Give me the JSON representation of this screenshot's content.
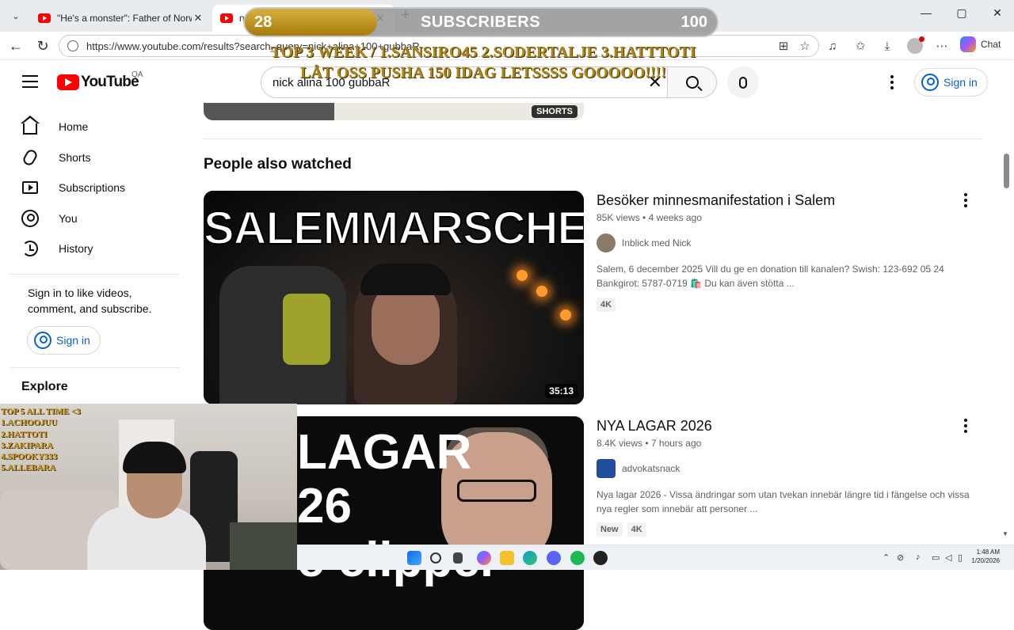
{
  "browser": {
    "tabs": [
      {
        "title": "\"He's a monster\": Father of Norwa",
        "active": false
      },
      {
        "title": "ni",
        "active": true
      }
    ],
    "url": "https://www.youtube.com/results?search_query=nick+alina+100+gubbaR",
    "chat_label": "Chat"
  },
  "youtube": {
    "logo_text": "YouTube",
    "country_code": "QA",
    "search_value": "nick alina 100 gubbaR",
    "signin_label": "Sign in"
  },
  "sidebar": {
    "items": [
      {
        "label": "Home",
        "icon": "home-icon"
      },
      {
        "label": "Shorts",
        "icon": "shorts-icon"
      },
      {
        "label": "Subscriptions",
        "icon": "subscriptions-icon"
      },
      {
        "label": "You",
        "icon": "you-icon"
      },
      {
        "label": "History",
        "icon": "history-icon"
      }
    ],
    "signin_prompt": "Sign in to like videos, comment, and subscribe.",
    "signin_label": "Sign in",
    "explore_label": "Explore"
  },
  "main": {
    "shorts_badge": "SHORTS",
    "section_title": "People also watched",
    "videos": [
      {
        "title": "Besöker minnesmanifestation i Salem",
        "views": "85K views",
        "age": "4 weeks ago",
        "channel": "Inblick med Nick",
        "description": "Salem, 6 december 2025 Vill du ge en donation till kanalen? Swish: 123-692 05 24 Bankgirot: 5787-0719 🛍️ Du kan även stötta ...",
        "badges": [
          "4K"
        ],
        "duration": "35:13",
        "thumb_text": "SALEMMARSCHEN"
      },
      {
        "title": "NYA LAGAR 2026",
        "views": "8.4K views",
        "age": "7 hours ago",
        "channel": "advokatsnack",
        "description": "Nya lagar 2026 - Vissa ändringar som utan tvekan innebär längre tid i fängelse och vissa nya regler som innebär att personer ...",
        "badges": [
          "New",
          "4K"
        ],
        "thumb_line1": "LAGAR",
        "thumb_line2": "26",
        "thumb_line3": "e clipper"
      }
    ]
  },
  "stream_overlay": {
    "subscriber_count": "28",
    "subscriber_label": "SUBSCRIBERS",
    "subscriber_goal": "100",
    "goal_progress": 0.28,
    "line1": "TOP 3 WEEK / 1.SANSIRO45 2.SODERTALJE 3.HATTTOTI",
    "line2": "LÅT OSS PUSHA 150 IDAG LETSSSS GOOOOO!!!!",
    "top5_title": "TOP 5 ALL TIME <3",
    "top5": [
      "1.ACHOOJUU",
      "2.HATTOTI",
      "3.ZAKIPARA",
      "4.SPOOKY333",
      "5.ALLEBARA"
    ]
  },
  "taskbar": {
    "time": "1:48 AM",
    "date": "1/20/2026"
  },
  "colors": {
    "youtube_red": "#ff0000",
    "link_blue": "#065fd4",
    "overlay_gold": "#b0861a"
  }
}
